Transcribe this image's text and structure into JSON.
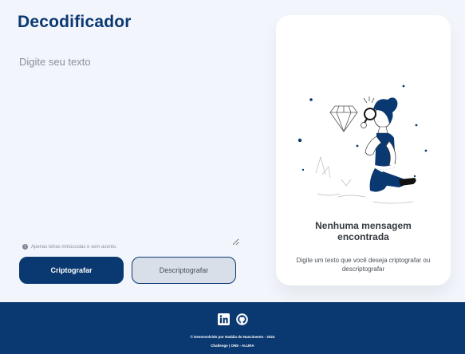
{
  "header": {
    "title": "Decodificador"
  },
  "input": {
    "placeholder": "Digite seu texto",
    "value": ""
  },
  "hint": {
    "icon": "info-icon",
    "icon_glyph": "!",
    "text": "Apenas letras minúsculas e sem acento."
  },
  "buttons": {
    "encrypt_label": "Criptografar",
    "decrypt_label": "Descriptografar"
  },
  "output_panel": {
    "illustration": "person-with-magnifying-glass-and-diamond-illustration",
    "title": "Nenhuma mensagem encontrada",
    "subtitle": "Digite um texto que você deseja criptografar ou descriptografar"
  },
  "footer": {
    "social": [
      {
        "name": "linkedin-icon"
      },
      {
        "name": "github-icon"
      }
    ],
    "credit": "© Desenvolvido por Natália do Nascimento - 2024",
    "challenge": "Challenge | ONE - ALURA"
  },
  "colors": {
    "primary": "#0a3871",
    "background": "#f3f5fc",
    "panel": "#ffffff",
    "secondary_button": "#d8dfe8"
  }
}
